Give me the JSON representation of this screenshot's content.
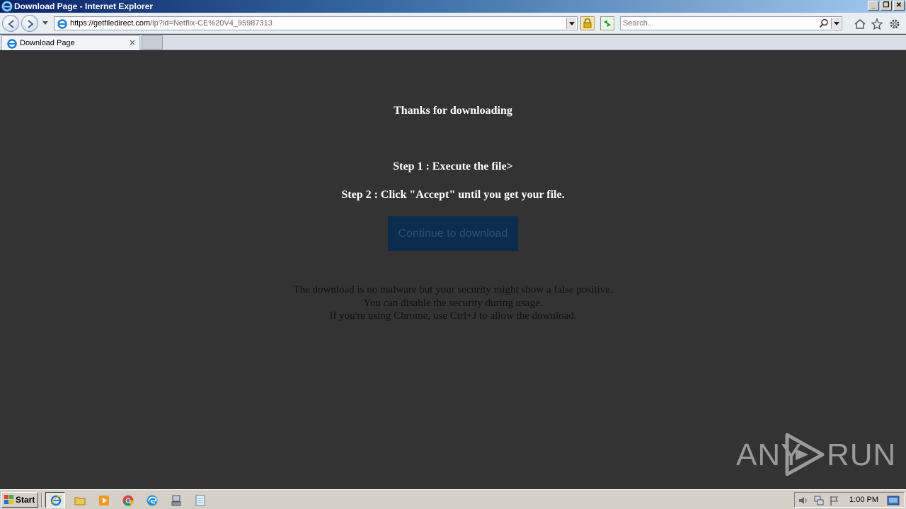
{
  "window": {
    "title": "Download Page - Internet Explorer"
  },
  "navbar": {
    "url_host": "https://getfiledirect.com",
    "url_path": "/lp?id=Netflix-CE%20V4_95987313",
    "search_placeholder": "Search..."
  },
  "tabs": [
    {
      "label": "Download Page",
      "close": "×"
    }
  ],
  "page": {
    "heading": "Thanks for downloading",
    "step1": "Step 1 : Execute the file>",
    "step2": "Step 2 : Click \"Accept\" until you get your file.",
    "button_label": "Continue to download",
    "note_lines": [
      "The download is no malware but your security might show a false positive.",
      "You can disable the security during usage.",
      "If you're using Chrome, use Ctrl+J to allow the download."
    ]
  },
  "watermark": {
    "left": "ANY",
    "right": "RUN"
  },
  "taskbar": {
    "start_label": "Start",
    "clock": "1:00 PM",
    "apps": [
      "internet-explorer",
      "file-explorer",
      "media-player",
      "chrome",
      "edge",
      "network-tool",
      "notepad"
    ]
  },
  "colors": {
    "page_bg": "#333333",
    "button_bg": "#0b2c4d",
    "button_text": "#2f4f70"
  }
}
